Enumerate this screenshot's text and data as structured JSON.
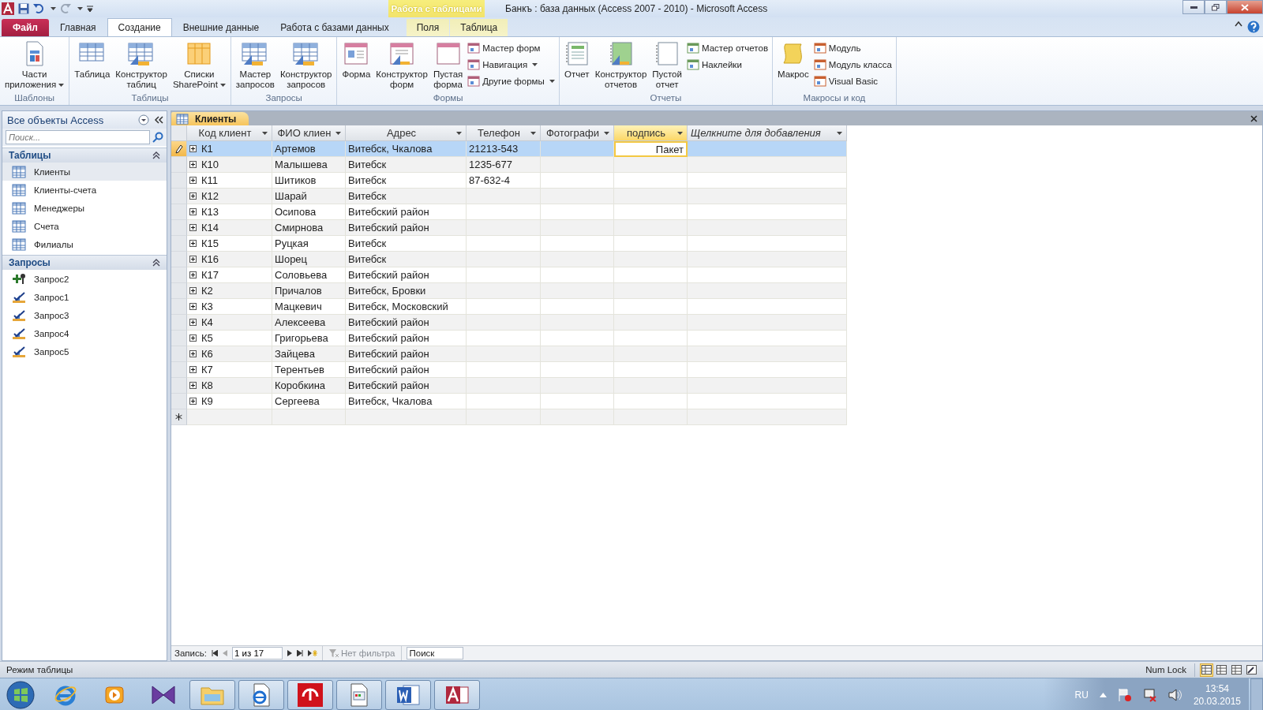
{
  "window": {
    "title": "Банкъ : база данных (Access 2007 - 2010)  -  Microsoft Access",
    "context_group": "Работа с таблицами"
  },
  "ribbon_tabs": [
    {
      "label": "Файл",
      "selected": false,
      "kind": "file"
    },
    {
      "label": "Главная",
      "selected": false,
      "kind": "normal"
    },
    {
      "label": "Создание",
      "selected": true,
      "kind": "normal"
    },
    {
      "label": "Внешние данные",
      "selected": false,
      "kind": "normal"
    },
    {
      "label": "Работа с базами данных",
      "selected": false,
      "kind": "normal"
    },
    {
      "label": "Поля",
      "selected": false,
      "kind": "context"
    },
    {
      "label": "Таблица",
      "selected": false,
      "kind": "context"
    }
  ],
  "ribbon_groups": [
    {
      "label": "Шаблоны",
      "large_buttons": [
        {
          "lines": [
            "Части",
            "приложения"
          ],
          "dropdown": true
        }
      ]
    },
    {
      "label": "Таблицы",
      "large_buttons": [
        {
          "lines": [
            "Таблица"
          ],
          "dropdown": false
        },
        {
          "lines": [
            "Конструктор",
            "таблиц"
          ],
          "dropdown": false
        },
        {
          "lines": [
            "Списки",
            "SharePoint"
          ],
          "dropdown": true
        }
      ]
    },
    {
      "label": "Запросы",
      "large_buttons": [
        {
          "lines": [
            "Мастер",
            "запросов"
          ],
          "dropdown": false
        },
        {
          "lines": [
            "Конструктор",
            "запросов"
          ],
          "dropdown": false
        }
      ]
    },
    {
      "label": "Формы",
      "large_buttons": [
        {
          "lines": [
            "Форма"
          ],
          "dropdown": false
        },
        {
          "lines": [
            "Конструктор",
            "форм"
          ],
          "dropdown": false
        },
        {
          "lines": [
            "Пустая",
            "форма"
          ],
          "dropdown": false
        }
      ],
      "small_buttons": [
        {
          "label": "Мастер форм",
          "dropdown": false
        },
        {
          "label": "Навигация",
          "dropdown": true
        },
        {
          "label": "Другие формы",
          "dropdown": true
        }
      ]
    },
    {
      "label": "Отчеты",
      "large_buttons": [
        {
          "lines": [
            "Отчет"
          ],
          "dropdown": false
        },
        {
          "lines": [
            "Конструктор",
            "отчетов"
          ],
          "dropdown": false
        },
        {
          "lines": [
            "Пустой",
            "отчет"
          ],
          "dropdown": false
        }
      ],
      "small_buttons": [
        {
          "label": "Мастер отчетов",
          "dropdown": false
        },
        {
          "label": "Наклейки",
          "dropdown": false
        }
      ]
    },
    {
      "label": "Макросы и код",
      "large_buttons": [
        {
          "lines": [
            "Макрос"
          ],
          "dropdown": false
        }
      ],
      "small_buttons": [
        {
          "label": "Модуль",
          "dropdown": false
        },
        {
          "label": "Модуль класса",
          "dropdown": false
        },
        {
          "label": "Visual Basic",
          "dropdown": false
        }
      ]
    }
  ],
  "nav_pane": {
    "title": "Все объекты Access",
    "search": {
      "placeholder": "Поиск..."
    },
    "sections": [
      {
        "title": "Таблицы",
        "expanded": true,
        "items": [
          {
            "label": "Клиенты",
            "kind": "table",
            "selected": true
          },
          {
            "label": "Клиенты-счета",
            "kind": "table",
            "selected": false
          },
          {
            "label": "Менеджеры",
            "kind": "table",
            "selected": false
          },
          {
            "label": "Счета",
            "kind": "table",
            "selected": false
          },
          {
            "label": "Филиалы",
            "kind": "table",
            "selected": false
          }
        ]
      },
      {
        "title": "Запросы",
        "expanded": true,
        "items": [
          {
            "label": "Запрос2",
            "kind": "append_query",
            "selected": false
          },
          {
            "label": "Запрос1",
            "kind": "select_query",
            "selected": false
          },
          {
            "label": "Запрос3",
            "kind": "select_query",
            "selected": false
          },
          {
            "label": "Запрос4",
            "kind": "select_query",
            "selected": false
          },
          {
            "label": "Запрос5",
            "kind": "select_query",
            "selected": false
          }
        ]
      }
    ]
  },
  "document_tab": {
    "title": "Клиенты"
  },
  "table": {
    "columns": [
      {
        "label": "Код клиент",
        "selected": false,
        "kind": "field"
      },
      {
        "label": "ФИО клиен",
        "selected": false,
        "kind": "field"
      },
      {
        "label": "Адрес",
        "selected": false,
        "kind": "field"
      },
      {
        "label": "Телефон",
        "selected": false,
        "kind": "field"
      },
      {
        "label": "Фотографи",
        "selected": false,
        "kind": "field"
      },
      {
        "label": "подпись",
        "selected": true,
        "kind": "field"
      },
      {
        "label": "Щелкните для добавления",
        "selected": false,
        "kind": "add"
      }
    ],
    "rows": [
      {
        "code": "К1",
        "name": "Артемов",
        "address": "Витебск, Чкалова",
        "phone": "21213-543",
        "signature": "Пакет",
        "selected": true,
        "editing": true
      },
      {
        "code": "К10",
        "name": "Малышева",
        "address": "Витебск",
        "phone": "1235-677",
        "selected": false,
        "editing": false
      },
      {
        "code": "К11",
        "name": "Шитиков",
        "address": "Витебск",
        "phone": "87-632-4",
        "selected": false,
        "editing": false
      },
      {
        "code": "К12",
        "name": "Шарай",
        "address": "Витебск",
        "selected": false,
        "editing": false
      },
      {
        "code": "К13",
        "name": "Осипова",
        "address": "Витебский район",
        "selected": false,
        "editing": false
      },
      {
        "code": "К14",
        "name": "Смирнова",
        "address": "Витебский район",
        "selected": false,
        "editing": false
      },
      {
        "code": "К15",
        "name": "Руцкая",
        "address": "Витебск",
        "selected": false,
        "editing": false
      },
      {
        "code": "К16",
        "name": "Шорец",
        "address": "Витебск",
        "selected": false,
        "editing": false
      },
      {
        "code": "К17",
        "name": "Соловьева",
        "address": "Витебский район",
        "selected": false,
        "editing": false
      },
      {
        "code": "К2",
        "name": "Причалов",
        "address": "Витебск, Бровки",
        "selected": false,
        "editing": false
      },
      {
        "code": "К3",
        "name": "Мацкевич",
        "address": "Витебск, Московский",
        "selected": false,
        "editing": false
      },
      {
        "code": "К4",
        "name": "Алексеева",
        "address": "Витебский район",
        "selected": false,
        "editing": false
      },
      {
        "code": "К5",
        "name": "Григорьева",
        "address": "Витебский район",
        "selected": false,
        "editing": false
      },
      {
        "code": "К6",
        "name": "Зайцева",
        "address": "Витебский район",
        "selected": false,
        "editing": false
      },
      {
        "code": "К7",
        "name": "Терентьев",
        "address": "Витебский район",
        "selected": false,
        "editing": false
      },
      {
        "code": "К8",
        "name": "Коробкина",
        "address": "Витебский район",
        "selected": false,
        "editing": false
      },
      {
        "code": "К9",
        "name": "Сергеева",
        "address": "Витебск, Чкалова",
        "selected": false,
        "editing": false
      }
    ]
  },
  "record_nav": {
    "label": "Запись:",
    "position": "1 из 17",
    "filter": {
      "label": "Нет фильтра",
      "disabled": true
    },
    "search": {
      "placeholder": "Поиск"
    }
  },
  "status_bar": {
    "text": "Режим таблицы",
    "indicator": "Num Lock",
    "views": [
      {
        "kind": "datasheet",
        "selected": true
      },
      {
        "kind": "pivot_table",
        "selected": false
      },
      {
        "kind": "pivot_chart",
        "selected": false
      },
      {
        "kind": "design",
        "selected": false
      }
    ]
  },
  "taskbar": {
    "apps": [
      {
        "kind": "browser",
        "open": false
      },
      {
        "kind": "media",
        "open": false
      },
      {
        "kind": "studio",
        "open": false
      },
      {
        "kind": "folder",
        "open": true
      },
      {
        "kind": "web_doc",
        "open": true
      },
      {
        "kind": "antivirus",
        "open": true
      },
      {
        "kind": "window_doc",
        "open": true
      },
      {
        "kind": "word",
        "open": true
      },
      {
        "kind": "access",
        "open": true
      }
    ],
    "tray": {
      "language": "RU",
      "time": "13:54",
      "date": "20.03.2015"
    }
  }
}
